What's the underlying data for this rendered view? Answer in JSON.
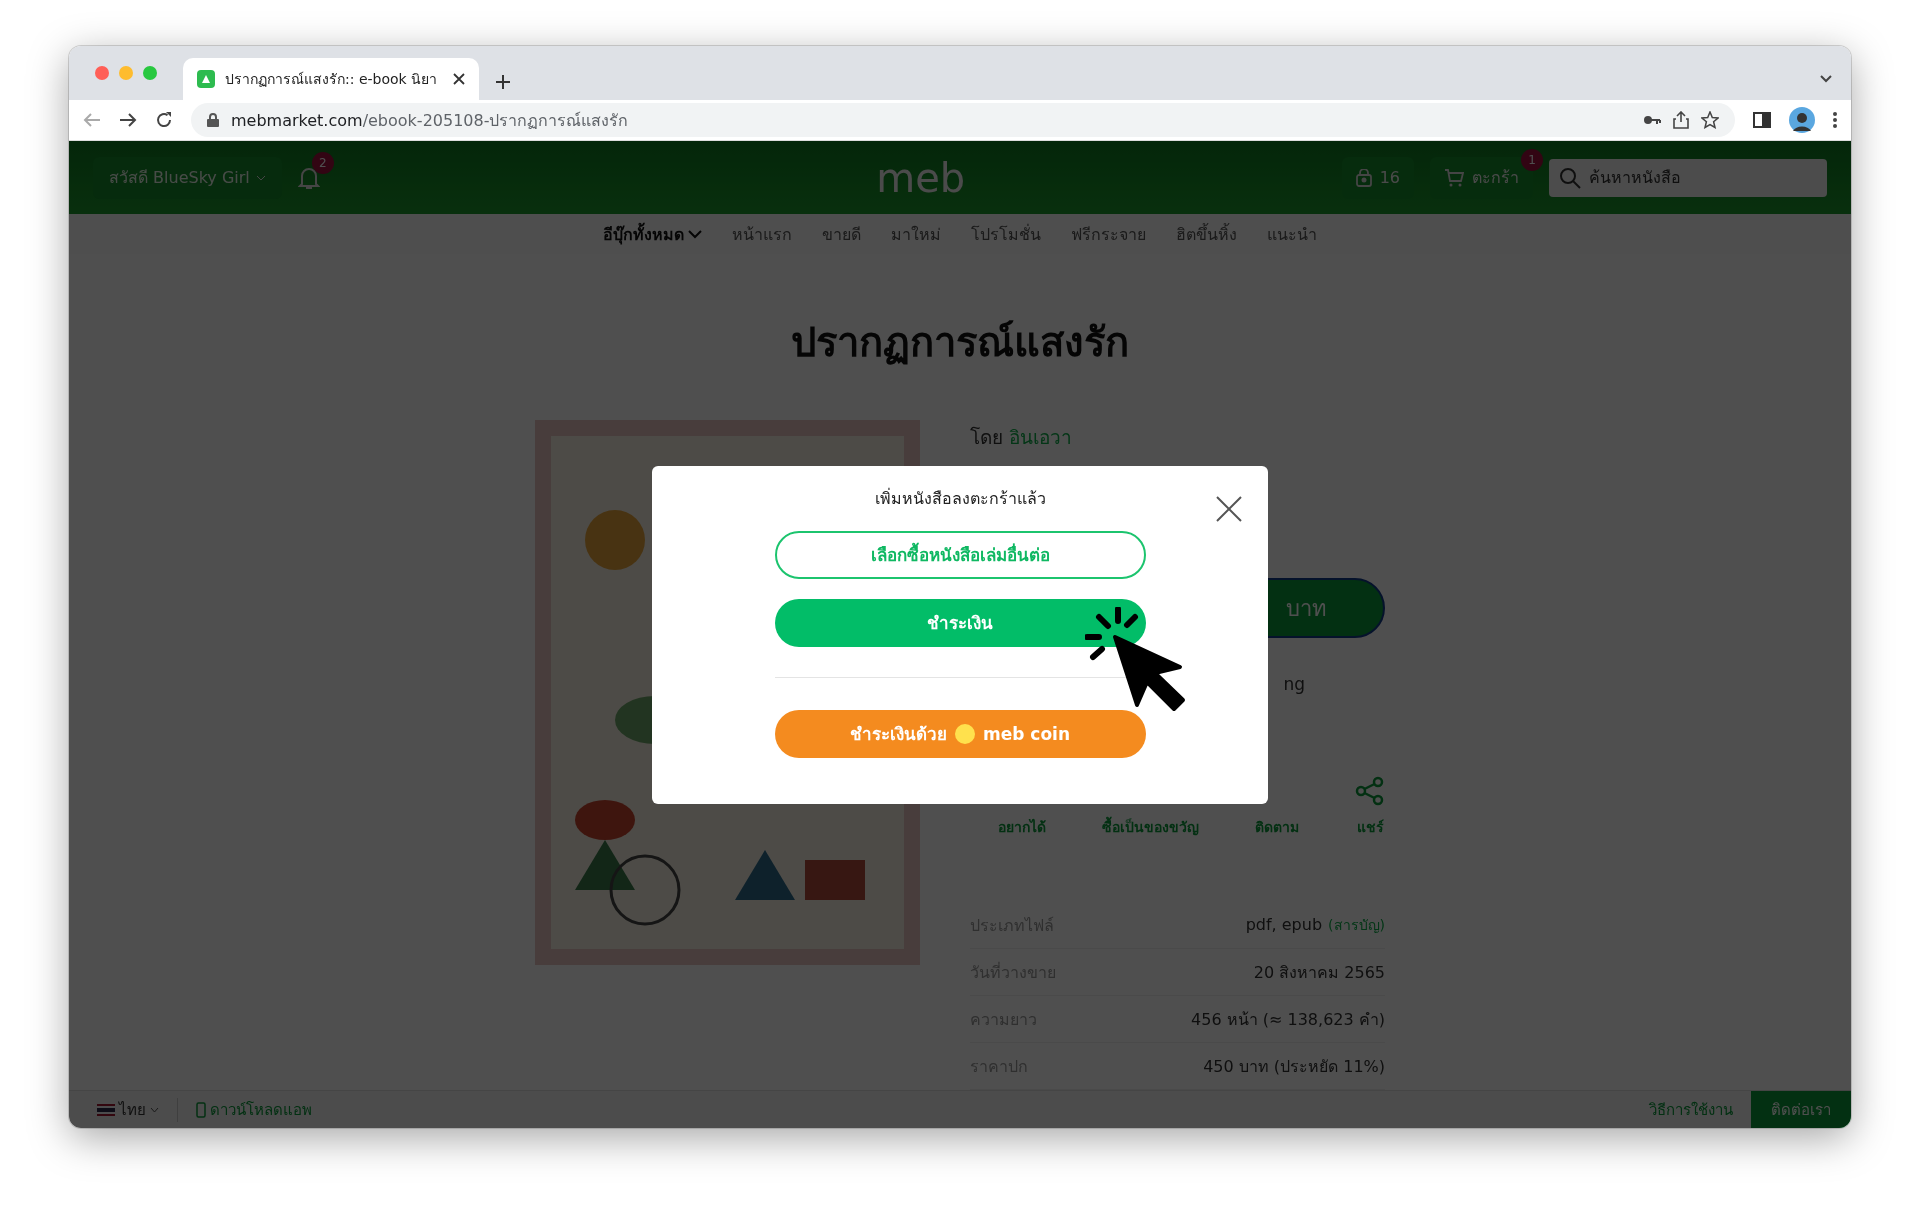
{
  "browser": {
    "tab": {
      "title": "ปรากฏการณ์แสงรัก:: e-book นิยา"
    },
    "url": {
      "host": "mebmarket.com",
      "path": "/ebook-205108-ปรากฏการณ์แสงรัก"
    }
  },
  "header": {
    "greeting": "สวัสดี BlueSky Girl",
    "notification_badge": "2",
    "logo": "meb",
    "coins": "16",
    "cart": {
      "label": "ตะกร้า",
      "badge": "1"
    },
    "search": {
      "placeholder": "ค้นหาหนังสือ"
    }
  },
  "nav": {
    "items": [
      {
        "label": "อีบุ๊กทั้งหมด",
        "kind": "dropdown"
      },
      {
        "label": "หน้าแรก",
        "kind": "link"
      },
      {
        "label": "ขายดี",
        "kind": "link"
      },
      {
        "label": "มาใหม่",
        "kind": "link"
      },
      {
        "label": "โปรโมชั่น",
        "kind": "link"
      },
      {
        "label": "ฟรีกระจาย",
        "kind": "link"
      },
      {
        "label": "ฮิตขึ้นหิ้ง",
        "kind": "link"
      },
      {
        "label": "แนะนำ",
        "kind": "link"
      }
    ]
  },
  "book": {
    "title": "ปรากฏการณ์แสงรัก",
    "author_prefix": "โดย",
    "author": "อินเอวา",
    "buy_button": "บาท",
    "note": "ng",
    "actions": [
      {
        "label": "อยากได้",
        "kind": "plain"
      },
      {
        "label": "ซื้อเป็นของขวัญ",
        "kind": "plain"
      },
      {
        "label": "ติดตาม",
        "kind": "plain"
      },
      {
        "label": "แชร์",
        "kind": "share"
      }
    ],
    "details": [
      {
        "label": "ประเภทไฟล์",
        "value": "pdf, epub",
        "link": "(สารบัญ)"
      },
      {
        "label": "วันที่วางขาย",
        "value": "20 สิงหาคม 2565"
      },
      {
        "label": "ความยาว",
        "value": "456 หน้า (≈ 138,623 คำ)"
      },
      {
        "label": "ราคาปก",
        "value": "450 บาท (ประหยัด 11%)"
      }
    ]
  },
  "dialog": {
    "title": "เพิ่มหนังสือลงตะกร้าแล้ว",
    "buttons": [
      {
        "label": "เลือกซื้อหนังสือเล่มอื่นต่อ",
        "kind": "outline"
      },
      {
        "label": "ชำระเงิน",
        "kind": "primary"
      },
      {
        "label": "ชำระเงินด้วย",
        "suffix": "meb coin",
        "kind": "coin"
      }
    ]
  },
  "footer": {
    "language": "ไทย",
    "download": "ดาวน์โหลดแอพ",
    "help": "วิธีการใช้งาน",
    "contact": "ติดต่อเรา"
  }
}
